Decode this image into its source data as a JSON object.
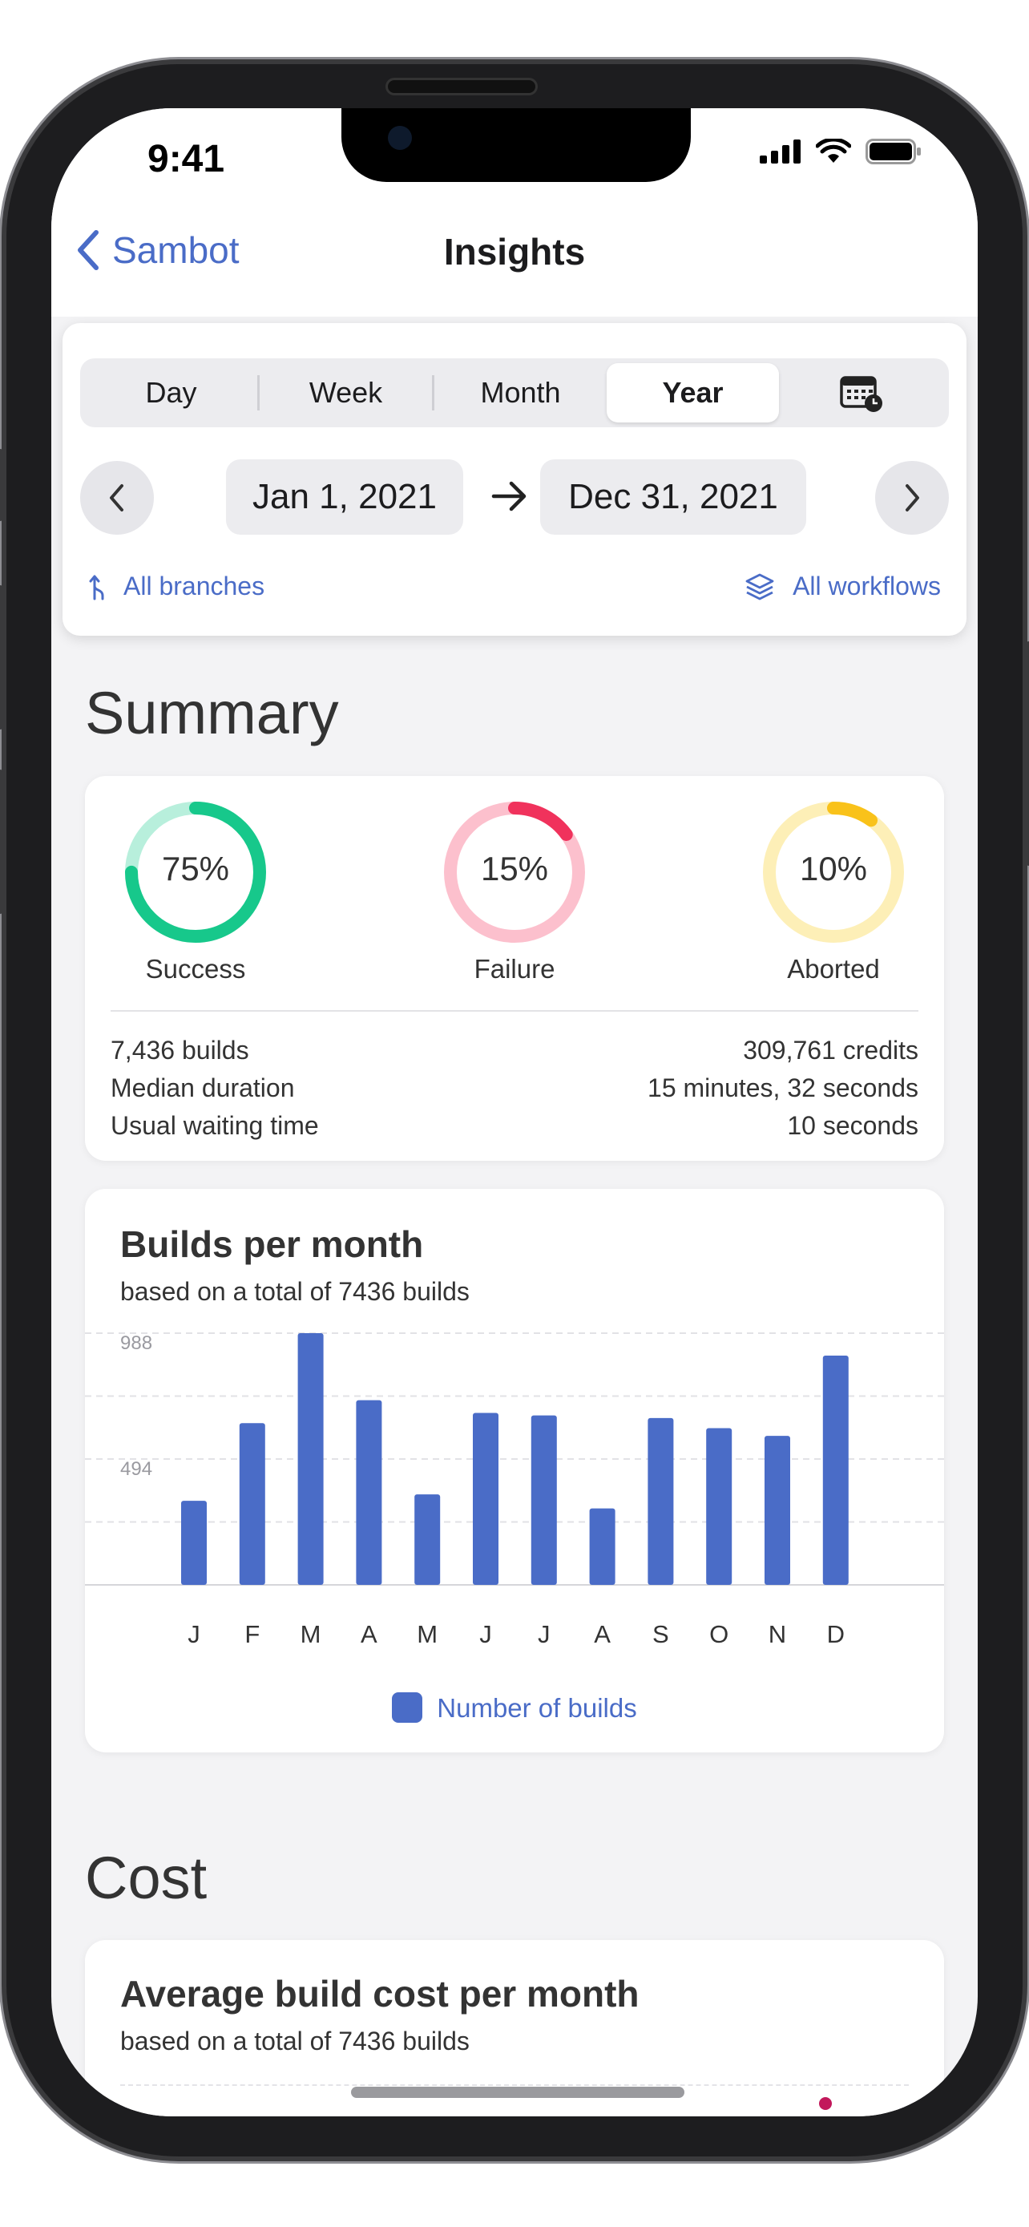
{
  "status": {
    "time": "9:41"
  },
  "nav": {
    "back_label": "Sambot",
    "title": "Insights"
  },
  "filters": {
    "periods": [
      "Day",
      "Week",
      "Month",
      "Year"
    ],
    "selected_period": "Year",
    "calendar_icon": "calendar-clock-icon",
    "start_date": "Jan 1, 2021",
    "end_date": "Dec 31, 2021",
    "branches_label": "All branches",
    "workflows_label": "All workflows"
  },
  "summary": {
    "title": "Summary",
    "rates": [
      {
        "pct": "75%",
        "label": "Success",
        "value": 0.75,
        "color": "#17c88b",
        "track": "#b8efdc"
      },
      {
        "pct": "15%",
        "label": "Failure",
        "value": 0.15,
        "color": "#f0325c",
        "track": "#fcc0cd"
      },
      {
        "pct": "10%",
        "label": "Aborted",
        "value": 0.1,
        "color": "#f9c21a",
        "track": "#fdefb7"
      }
    ],
    "stats": [
      {
        "left": "7,436 builds",
        "right": "309,761 credits"
      },
      {
        "left": "Median duration",
        "right": "15 minutes, 32 seconds"
      },
      {
        "left": "Usual waiting time",
        "right": "10 seconds"
      }
    ]
  },
  "builds_chart": {
    "title": "Builds per month",
    "subtitle": "based on a total of 7436 builds",
    "legend": "Number of builds",
    "color": "#4a6cc7"
  },
  "chart_data": {
    "type": "bar",
    "title": "Builds per month",
    "categories": [
      "J",
      "F",
      "M",
      "A",
      "M",
      "J",
      "J",
      "A",
      "S",
      "O",
      "N",
      "D"
    ],
    "series": [
      {
        "name": "Number of builds",
        "values": [
          330,
          635,
          988,
          725,
          355,
          675,
          665,
          300,
          655,
          615,
          585,
          900
        ]
      }
    ],
    "ytick_labels": [
      "988",
      "494"
    ],
    "ylim": [
      0,
      988
    ],
    "grid": true,
    "legend": "bottom-center"
  },
  "cost": {
    "title": "Cost",
    "chart_title": "Average build cost per month",
    "chart_subtitle": "based on a total of 7436 builds"
  }
}
